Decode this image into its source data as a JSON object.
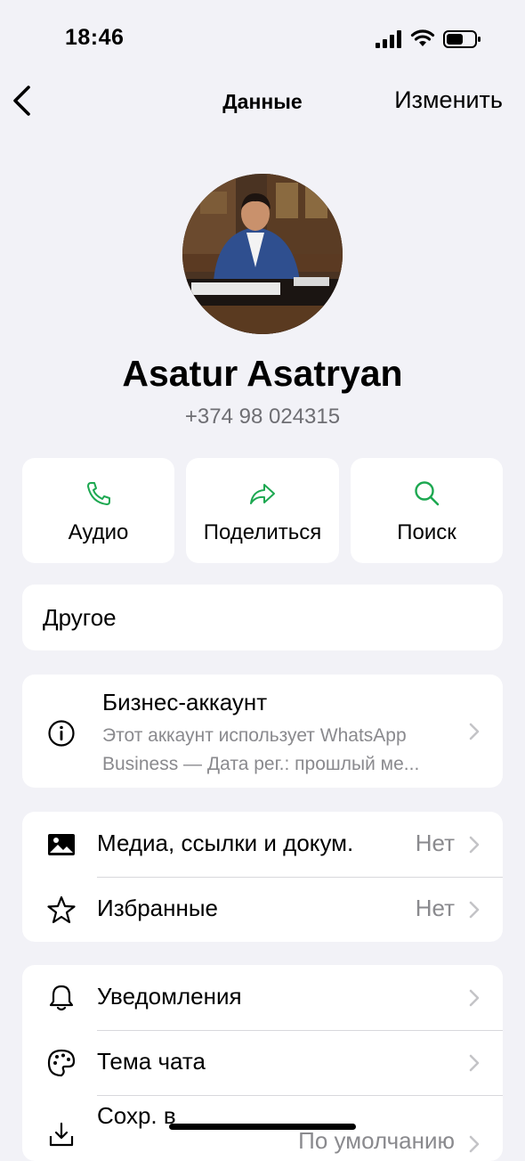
{
  "status_bar": {
    "time": "18:46"
  },
  "nav": {
    "title": "Данные",
    "edit_label": "Изменить"
  },
  "profile": {
    "name": "Asatur Asatryan",
    "phone": "+374 98 024315"
  },
  "actions": [
    {
      "label": "Аудио",
      "icon": "phone-icon"
    },
    {
      "label": "Поделиться",
      "icon": "share-icon"
    },
    {
      "label": "Поиск",
      "icon": "search-icon"
    }
  ],
  "other": {
    "label": "Другое"
  },
  "business": {
    "title": "Бизнес-аккаунт",
    "line1": "Этот аккаунт использует WhatsApp",
    "line2": "Business — Дата рег.: прошлый ме..."
  },
  "media_section": [
    {
      "label": "Медиа, ссылки и докум.",
      "value": "Нет",
      "icon": "photo-icon"
    },
    {
      "label": "Избранные",
      "value": "Нет",
      "icon": "star-icon"
    }
  ],
  "settings_section": [
    {
      "label": "Уведомления",
      "value": "",
      "icon": "bell-icon"
    },
    {
      "label": "Тема чата",
      "value": "",
      "icon": "palette-icon"
    },
    {
      "label": "Сохр. в",
      "value": "По умолчанию",
      "icon": "save-icon"
    }
  ],
  "colors": {
    "accent": "#1da851",
    "background": "#f2f2f7",
    "secondary_text": "#8a8a8e"
  }
}
